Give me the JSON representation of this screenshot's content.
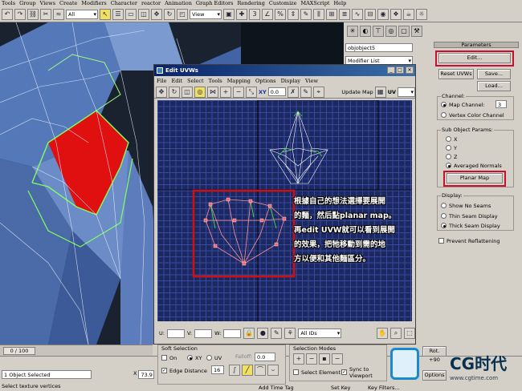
{
  "menu": [
    "Tools",
    "Group",
    "Views",
    "Create",
    "Modifiers",
    "Character",
    "reactor",
    "Animation",
    "Graph Editors",
    "Rendering",
    "Customize",
    "MAXScript",
    "Help"
  ],
  "toolbar": {
    "filter_value": "All",
    "refcoord_value": "View"
  },
  "command_panel": {
    "object_name": "objobject5",
    "modifier_list": "Modifier List",
    "rollout_title": "Parameters",
    "edit_button": "Edit...",
    "reset_uvws": "Reset UVWs",
    "save": "Save...",
    "load": "Load...",
    "channel_group": "Channel:",
    "map_channel_label": "Map Channel:",
    "map_channel_value": "3",
    "vertex_color_channel": "Vertex Color Channel",
    "subobj_group": "Sub Object Params:",
    "axis_x": "X",
    "axis_y": "Y",
    "axis_z": "Z",
    "averaged_normals": "Averaged Normals",
    "planar_map": "Planar Map",
    "display_group": "Display:",
    "show_no_seams": "Show No Seams",
    "thin_seam": "Thin Seam Display",
    "thick_seam": "Thick Seam Display",
    "prevent_reflattening": "Prevent Reflattening"
  },
  "uvw_window": {
    "title": "Edit UVWs",
    "menu": [
      "File",
      "Edit",
      "Select",
      "Tools",
      "Mapping",
      "Options",
      "Display",
      "View"
    ],
    "xy_label": "XY",
    "spin_value": "0.0",
    "update_map": "Update Map",
    "uv_label": "UV",
    "u_label": "U:",
    "v_label": "V:",
    "w_label": "W:",
    "ids_value": "All IDs"
  },
  "annotation_lines": [
    "根據自己的想法選擇要展開",
    "的麵，然后點planar map。",
    "再edit UVW就可以看到展開",
    "的效果，把牠移動到需的地",
    "方以便和其他麵區分。"
  ],
  "soft_selection": {
    "title": "Soft Selection",
    "on": "On",
    "xy": "XY",
    "uv": "UV",
    "falloff": "Falloff:",
    "falloff_value": "0.0",
    "edge_distance": "Edge Distance",
    "edge_value": "16"
  },
  "selection_modes": {
    "title": "Selection Modes",
    "select_element": "Select Element",
    "sync": "Sync to Viewport"
  },
  "rot_label": "Rot. +90",
  "options_label": "Options",
  "timeline": {
    "frame": "0 / 100",
    "ticks": [
      "0",
      "10",
      "20",
      "30",
      "40",
      "50",
      "60"
    ]
  },
  "status": {
    "object_selected": "1 Object Selected",
    "prompt": "Select texture vertices",
    "x_label": "X",
    "x_value": "73.9",
    "add_time_tag": "Add Time Tag",
    "set_key": "Set Key",
    "key_filters": "Key Filters..."
  },
  "logo": {
    "text": "CG时代",
    "sub": "www.cgtime.com"
  }
}
